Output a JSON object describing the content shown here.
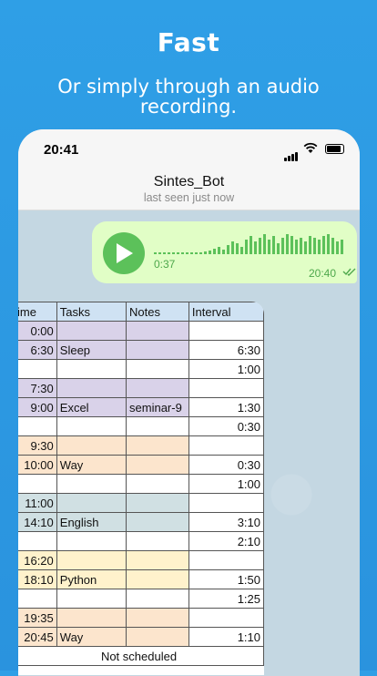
{
  "promo": {
    "headline": "Fast",
    "subline": "Or simply through an audio recording."
  },
  "status_bar": {
    "time": "20:41"
  },
  "chat_header": {
    "name": "Sintes_Bot",
    "status": "last seen just now"
  },
  "voice_message": {
    "duration": "0:37",
    "timestamp": "20:40"
  },
  "schedule": {
    "headers": [
      "ime",
      "Tasks",
      "Notes",
      "Interval"
    ],
    "rows": [
      {
        "time": "0:00",
        "task": "",
        "note": "",
        "interval": "",
        "color": "purple"
      },
      {
        "time": "6:30",
        "task": "Sleep",
        "note": "",
        "interval": "6:30",
        "color": "purple"
      },
      {
        "time": "",
        "task": "",
        "note": "",
        "interval": "1:00",
        "color": "white"
      },
      {
        "time": "7:30",
        "task": "",
        "note": "",
        "interval": "",
        "color": "purple"
      },
      {
        "time": "9:00",
        "task": "Excel",
        "note": "seminar-9",
        "interval": "1:30",
        "color": "purple"
      },
      {
        "time": "",
        "task": "",
        "note": "",
        "interval": "0:30",
        "color": "white"
      },
      {
        "time": "9:30",
        "task": "",
        "note": "",
        "interval": "",
        "color": "orange"
      },
      {
        "time": "10:00",
        "task": "Way",
        "note": "",
        "interval": "0:30",
        "color": "orange"
      },
      {
        "time": "",
        "task": "",
        "note": "",
        "interval": "1:00",
        "color": "white"
      },
      {
        "time": "11:00",
        "task": "",
        "note": "",
        "interval": "",
        "color": "teal"
      },
      {
        "time": "14:10",
        "task": "English",
        "note": "",
        "interval": "3:10",
        "color": "teal"
      },
      {
        "time": "",
        "task": "",
        "note": "",
        "interval": "2:10",
        "color": "white"
      },
      {
        "time": "16:20",
        "task": "",
        "note": "",
        "interval": "",
        "color": "yellow"
      },
      {
        "time": "18:10",
        "task": "Python",
        "note": "",
        "interval": "1:50",
        "color": "yellow"
      },
      {
        "time": "",
        "task": "",
        "note": "",
        "interval": "1:25",
        "color": "white"
      },
      {
        "time": "19:35",
        "task": "",
        "note": "",
        "interval": "",
        "color": "orange"
      },
      {
        "time": "20:45",
        "task": "Way",
        "note": "",
        "interval": "1:10",
        "color": "orange"
      }
    ],
    "footer": "Not scheduled"
  }
}
